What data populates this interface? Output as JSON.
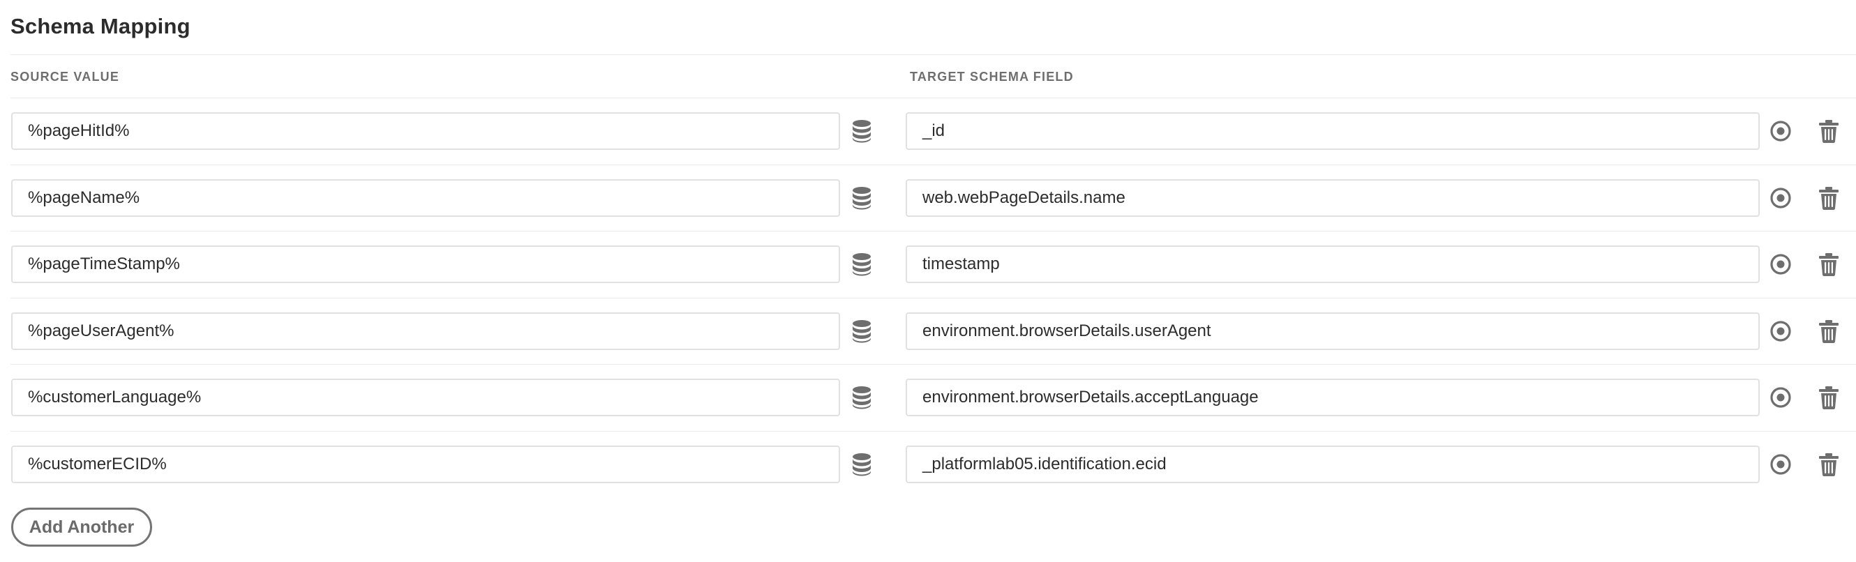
{
  "title": "Schema Mapping",
  "columns": {
    "source": "SOURCE VALUE",
    "target": "TARGET SCHEMA FIELD"
  },
  "rows": [
    {
      "source": "%pageHitId%",
      "target": "_id"
    },
    {
      "source": "%pageName%",
      "target": "web.webPageDetails.name"
    },
    {
      "source": "%pageTimeStamp%",
      "target": "timestamp"
    },
    {
      "source": "%pageUserAgent%",
      "target": "environment.browserDetails.userAgent"
    },
    {
      "source": "%customerLanguage%",
      "target": "environment.browserDetails.acceptLanguage"
    },
    {
      "source": "%customerECID%",
      "target": "_platformlab05.identification.ecid"
    }
  ],
  "icons": {
    "data_element": "database-icon",
    "select_target": "target-icon",
    "delete": "trash-icon"
  },
  "add_button_label": "Add Another",
  "colors": {
    "text": "#2c2c2c",
    "muted": "#6e6e6e",
    "icon": "#6e6e6e",
    "border": "#e1e1e1"
  }
}
